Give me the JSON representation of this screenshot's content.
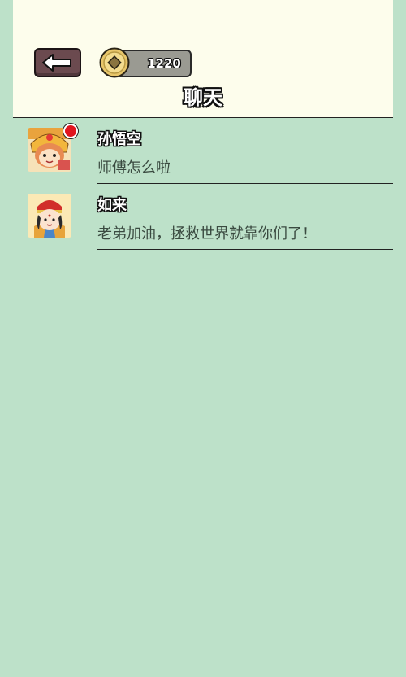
{
  "header": {
    "title": "聊天",
    "coins": "1220"
  },
  "colors": {
    "page_bg": "#bde1c9",
    "header_bg": "#fdfdec",
    "back_button": "#6b4a4f",
    "coin_pill": "#9a9a92",
    "unread_badge": "#e0141e"
  },
  "icons": {
    "back": "left-arrow-icon",
    "coin": "copper-coin-icon"
  },
  "chats": [
    {
      "name": "孙悟空",
      "message": "师傅怎么啦",
      "avatar": "sun-wukong-avatar",
      "unread": true
    },
    {
      "name": "如来",
      "message": "老弟加油，拯救世界就靠你们了！",
      "avatar": "rulai-avatar",
      "unread": false
    }
  ]
}
